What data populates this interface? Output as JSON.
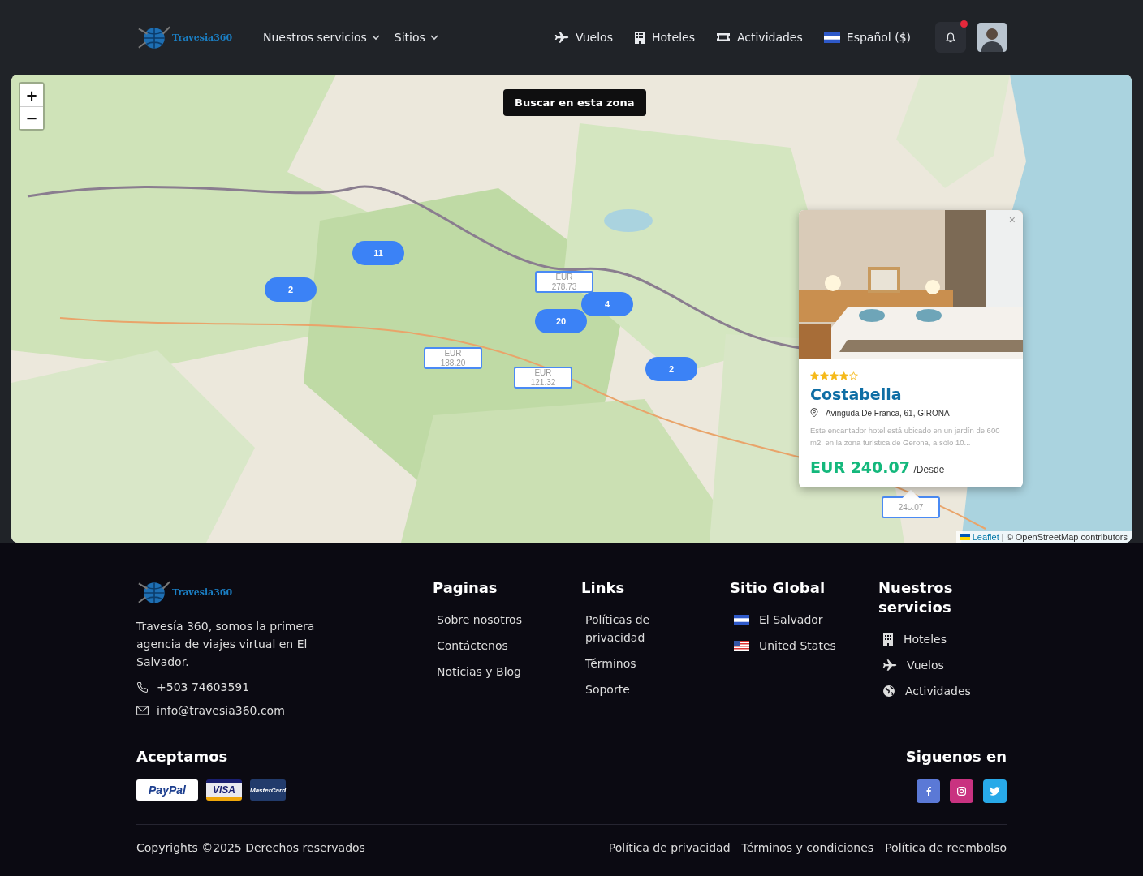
{
  "header": {
    "logo": "Travesia360",
    "menu": [
      {
        "label": "Nuestros servicios"
      },
      {
        "label": "Sitios"
      }
    ],
    "links": [
      {
        "label": "Vuelos"
      },
      {
        "label": "Hoteles"
      },
      {
        "label": "Actividades"
      }
    ],
    "language": "Español ($)",
    "notifications": {
      "unread": true
    }
  },
  "map": {
    "search_button": "Buscar en esta zona",
    "zoom_in": "+",
    "zoom_out": "−",
    "clusters": [
      {
        "count": "11"
      },
      {
        "count": "2"
      },
      {
        "count": "4"
      },
      {
        "count": "20"
      },
      {
        "count": "2"
      }
    ],
    "prices": [
      {
        "currency": "EUR",
        "amount": "278.73"
      },
      {
        "currency": "EUR",
        "amount": "188.20"
      },
      {
        "currency": "EUR",
        "amount": "121.32"
      },
      {
        "amount": "240.07"
      }
    ],
    "popup": {
      "stars": 4,
      "name": "Costabella",
      "address": "Avinguda De Franca, 61, GIRONA",
      "description": "Este encantador hotel está ubicado en un jardín de 600 m2, en la zona turística de Gerona, a sólo 10...",
      "price": "EUR 240.07",
      "price_suffix": "/Desde",
      "close": "×"
    },
    "attribution": {
      "link": "Leaflet",
      "text": "| © OpenStreetMap contributors"
    }
  },
  "footer": {
    "logo": "Travesia360",
    "about": "Travesía 360, somos la primera agencia de viajes virtual en El Salvador.",
    "phone": "+503 74603591",
    "email": "info@travesia360.com",
    "columns": [
      {
        "title": "Paginas",
        "items": [
          "Sobre nosotros",
          "Contáctenos",
          "Noticias y Blog"
        ]
      },
      {
        "title": "Links",
        "items": [
          "Políticas de privacidad",
          "Términos",
          "Soporte"
        ]
      }
    ],
    "global": {
      "title": "Sitio Global",
      "items": [
        "El Salvador",
        "United States"
      ]
    },
    "services": {
      "title": "Nuestros servicios",
      "items": [
        "Hoteles",
        "Vuelos",
        "Actividades"
      ]
    },
    "payments": {
      "title": "Aceptamos",
      "cards": [
        "PayPal",
        "VISA",
        "MasterCard"
      ]
    },
    "social": {
      "title": "Siguenos en"
    },
    "copyright": "Copyrights ©2025 Derechos reservados",
    "legal": [
      "Política de privacidad",
      "Términos y condiciones",
      "Política de reembolso"
    ]
  }
}
